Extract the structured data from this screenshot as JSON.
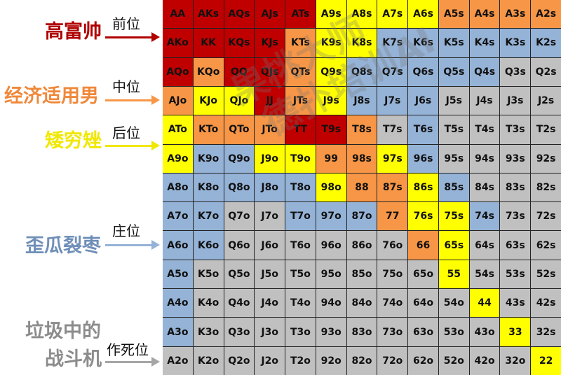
{
  "legend": [
    {
      "category": "高富帅",
      "position": "前位",
      "color": "#c00000"
    },
    {
      "category": "经济适用男",
      "position": "中位",
      "color": "#f79646"
    },
    {
      "category": "矮穷矬",
      "position": "后位",
      "color": "#ffff00"
    },
    {
      "category": "歪瓜裂枣",
      "position": "庄位",
      "color": "#95b3d7"
    },
    {
      "category": "垃圾中的",
      "category2": "战斗机",
      "position": "作死位",
      "color": "#a6a6a6"
    }
  ],
  "watermark": [
    "果桃大师",
    "德扑培训AI"
  ],
  "rows": [
    [
      "AA",
      "AKs",
      "AQs",
      "AJs",
      "ATs",
      "A9s",
      "A8s",
      "A7s",
      "A6s",
      "A5s",
      "A4s",
      "A3s",
      "A2s"
    ],
    [
      "AKo",
      "KK",
      "KQs",
      "KJs",
      "KTs",
      "K9s",
      "K8s",
      "K7s",
      "K6s",
      "K5s",
      "K4s",
      "K3s",
      "K2s"
    ],
    [
      "AQo",
      "KQo",
      "QQ",
      "QJs",
      "QTs",
      "Q9s",
      "Q8s",
      "Q7s",
      "Q6s",
      "Q5s",
      "Q4s",
      "Q3s",
      "Q2s"
    ],
    [
      "AJo",
      "KJo",
      "QJo",
      "JJ",
      "JTs",
      "J9s",
      "J8s",
      "J7s",
      "J6s",
      "J5s",
      "J4s",
      "J3s",
      "J2s"
    ],
    [
      "ATo",
      "KTo",
      "QTo",
      "JTo",
      "TT",
      "T9s",
      "T8s",
      "T7s",
      "T6s",
      "T5s",
      "T4s",
      "T3s",
      "T2s"
    ],
    [
      "A9o",
      "K9o",
      "Q9o",
      "J9o",
      "T9o",
      "99",
      "98s",
      "97s",
      "96s",
      "95s",
      "94s",
      "93s",
      "92s"
    ],
    [
      "A8o",
      "K8o",
      "Q8o",
      "J8o",
      "T8o",
      "98o",
      "88",
      "87s",
      "86s",
      "85s",
      "84s",
      "83s",
      "82s"
    ],
    [
      "A7o",
      "K7o",
      "Q7o",
      "J7o",
      "T7o",
      "97o",
      "87o",
      "77",
      "76s",
      "75s",
      "74s",
      "73s",
      "72s"
    ],
    [
      "A6o",
      "K6o",
      "Q6o",
      "J6o",
      "T6o",
      "96o",
      "86o",
      "76o",
      "66",
      "65s",
      "64s",
      "63s",
      "62s"
    ],
    [
      "A5o",
      "K5o",
      "Q5o",
      "J5o",
      "T5o",
      "95o",
      "85o",
      "75o",
      "65o",
      "55",
      "54s",
      "53s",
      "52s"
    ],
    [
      "A4o",
      "K4o",
      "Q4o",
      "J4o",
      "T4o",
      "94o",
      "84o",
      "74o",
      "64o",
      "54o",
      "44",
      "43s",
      "42s"
    ],
    [
      "A3o",
      "K3o",
      "Q3o",
      "J3o",
      "T3o",
      "93o",
      "83o",
      "73o",
      "63o",
      "53o",
      "43o",
      "33",
      "32s"
    ],
    [
      "A2o",
      "K2o",
      "Q2o",
      "J2o",
      "T2o",
      "92o",
      "82o",
      "72o",
      "62o",
      "52o",
      "42o",
      "32o",
      "22"
    ]
  ],
  "colors": [
    [
      "red",
      "red",
      "red",
      "red",
      "red",
      "yellow",
      "yellow",
      "yellow",
      "yellow",
      "orange",
      "orange",
      "orange",
      "orange"
    ],
    [
      "red",
      "red",
      "red",
      "red",
      "orange",
      "yellow",
      "yellow",
      "blue",
      "blue",
      "blue",
      "blue",
      "blue",
      "blue"
    ],
    [
      "red",
      "orange",
      "red",
      "red",
      "orange",
      "yellow",
      "blue",
      "blue",
      "blue",
      "blue",
      "blue",
      "gray",
      "gray"
    ],
    [
      "orange",
      "yellow",
      "yellow",
      "red",
      "orange",
      "yellow",
      "blue",
      "blue",
      "blue",
      "gray",
      "gray",
      "gray",
      "gray"
    ],
    [
      "yellow",
      "orange",
      "orange",
      "orange",
      "red",
      "red",
      "orange",
      "gray",
      "blue",
      "gray",
      "gray",
      "gray",
      "gray"
    ],
    [
      "yellow",
      "blue",
      "blue",
      "yellow",
      "yellow",
      "orange",
      "orange",
      "yellow",
      "blue",
      "gray",
      "gray",
      "gray",
      "gray"
    ],
    [
      "blue",
      "blue",
      "blue",
      "blue",
      "blue",
      "yellow",
      "orange",
      "orange",
      "yellow",
      "blue",
      "gray",
      "gray",
      "gray"
    ],
    [
      "blue",
      "blue",
      "gray",
      "gray",
      "blue",
      "blue",
      "blue",
      "orange",
      "yellow",
      "yellow",
      "blue",
      "gray",
      "gray"
    ],
    [
      "blue",
      "blue",
      "gray",
      "gray",
      "gray",
      "gray",
      "gray",
      "gray",
      "orange",
      "yellow",
      "gray",
      "gray",
      "gray"
    ],
    [
      "blue",
      "gray",
      "gray",
      "gray",
      "gray",
      "gray",
      "gray",
      "gray",
      "gray",
      "yellow",
      "gray",
      "gray",
      "gray"
    ],
    [
      "blue",
      "gray",
      "gray",
      "gray",
      "gray",
      "gray",
      "gray",
      "gray",
      "gray",
      "gray",
      "yellow",
      "gray",
      "gray"
    ],
    [
      "blue",
      "gray",
      "gray",
      "gray",
      "gray",
      "gray",
      "gray",
      "gray",
      "gray",
      "gray",
      "gray",
      "yellow",
      "gray"
    ],
    [
      "gray",
      "gray",
      "gray",
      "gray",
      "gray",
      "gray",
      "gray",
      "gray",
      "gray",
      "gray",
      "gray",
      "gray",
      "yellow"
    ]
  ]
}
